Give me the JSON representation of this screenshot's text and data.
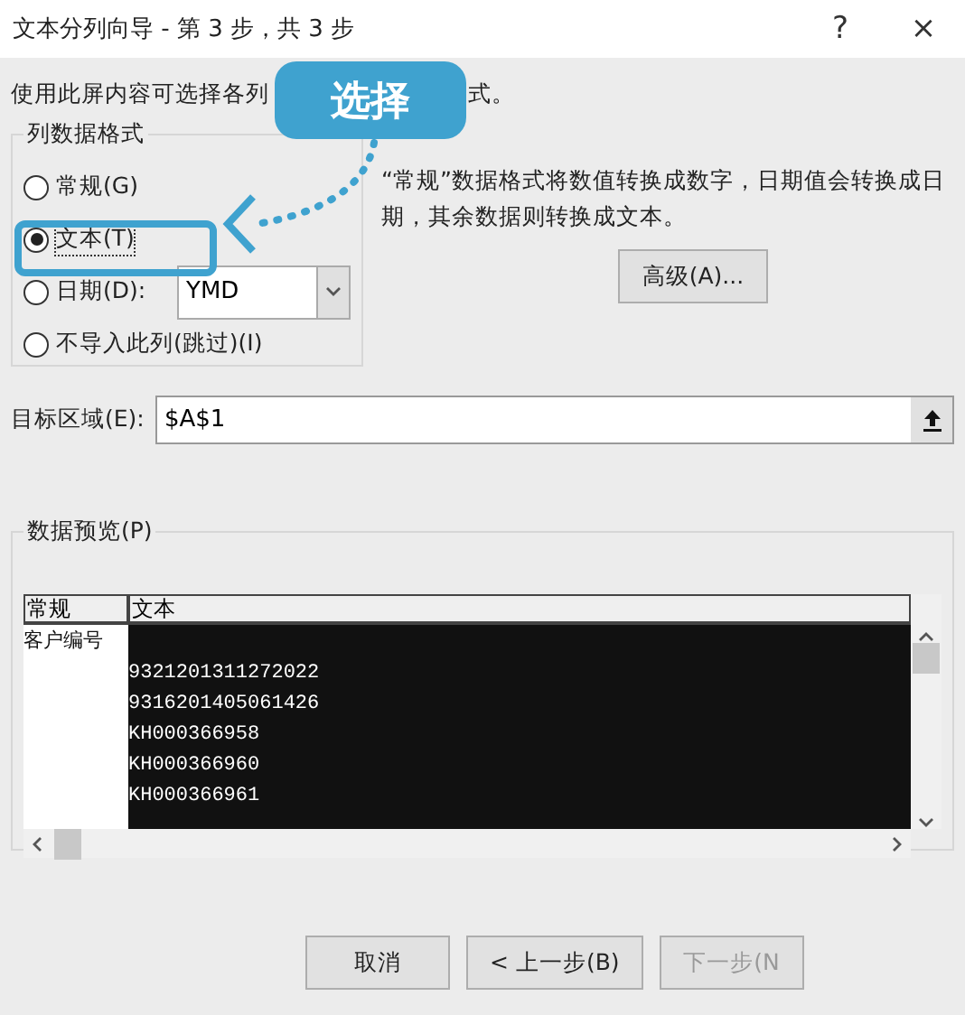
{
  "window": {
    "title": "文本分列向导 - 第 3 步，共 3 步",
    "help": "?",
    "close": "×"
  },
  "intro": {
    "before": "使用此屏内容可选择各列",
    "after": "式。"
  },
  "callout": {
    "label": "选择"
  },
  "format_group": {
    "title": "列数据格式",
    "options": [
      {
        "label": "常规(G)",
        "selected": false
      },
      {
        "label": "文本(T)",
        "selected": true
      },
      {
        "label": "日期(D):",
        "selected": false,
        "dropdown": "YMD"
      },
      {
        "label": "不导入此列(跳过)(I)",
        "selected": false
      }
    ]
  },
  "description": "“常规”数据格式将数值转换成数字，日期值会转换成日期，其余数据则转换成文本。",
  "advanced_button": "高级(A)...",
  "destination": {
    "label": "目标区域(E):",
    "value": "$A$1"
  },
  "preview": {
    "title": "数据预览(P)",
    "columns": [
      {
        "header": "常规",
        "selected": false
      },
      {
        "header": "文本",
        "selected": true
      }
    ],
    "rows": [
      [
        "客户编号",
        null
      ],
      [
        null,
        "9321201311272022"
      ],
      [
        null,
        "9316201405061426"
      ],
      [
        null,
        "KH000366958"
      ],
      [
        null,
        "KH000366960"
      ],
      [
        null,
        "KH000366961"
      ]
    ]
  },
  "buttons": [
    {
      "label": "取消",
      "disabled": false
    },
    {
      "label": "< 上一步(B)",
      "disabled": false
    },
    {
      "label": "下一步(N",
      "disabled": true
    }
  ]
}
